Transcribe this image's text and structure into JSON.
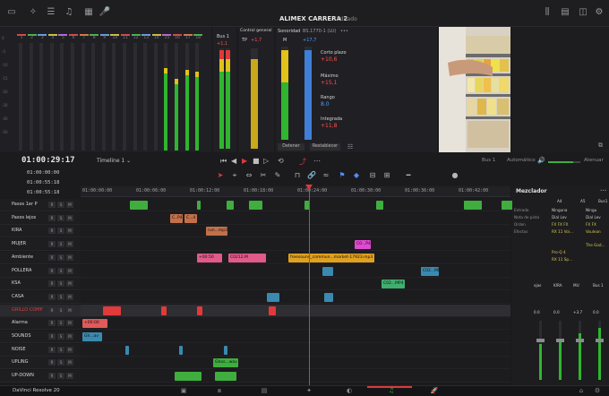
{
  "app": {
    "project_title": "ALIMEX CARRERA 2",
    "project_status": "Editado",
    "brand": "DaVinci Resolve 20"
  },
  "meters": {
    "channel_numbers": [
      "1",
      "2",
      "3",
      "4",
      "5",
      "6",
      "7",
      "8",
      "9",
      "10",
      "11",
      "12",
      "13",
      "14",
      "15",
      "16",
      "17",
      "18"
    ],
    "cap_colors": [
      "#d04a4a",
      "#4fae4f",
      "#6b9ae0",
      "#c8c04a",
      "#b06ad0",
      "#d04a4a",
      "#d07a4a",
      "#4fae4f",
      "#6b9ae0",
      "#c8c04a",
      "#d04a4a",
      "#4fae4f",
      "#6b9ae0",
      "#c8c04a",
      "#b06ad0",
      "#d04a4a",
      "#d07a4a",
      "#4fae4f"
    ],
    "levels": [
      0,
      0,
      0,
      0,
      0,
      0,
      0,
      0,
      0,
      0,
      0,
      0,
      0,
      0,
      0.72,
      0.62,
      0.7,
      0.68
    ],
    "scale_labels": [
      "0",
      "-5",
      "-10",
      "-15",
      "-20",
      "-30",
      "-40",
      "-50"
    ]
  },
  "bus_meter": {
    "label": "Bus 1",
    "value": "+1,1"
  },
  "control": {
    "label": "Control general",
    "tp_label": "TP",
    "tp_value": "+1,7"
  },
  "loudness": {
    "label": "Sonoridad",
    "standard": "BS.1770-1 (LU)",
    "m_label": "M",
    "m_value": "+17,7",
    "corto_plazo_label": "Corto plazo",
    "corto_plazo_value": "+10,6",
    "maximo_label": "Máximo",
    "maximo_value": "+15,1",
    "rango_label": "Rango",
    "rango_value": "8.0",
    "integrada_label": "Integrada",
    "integrada_value": "+11,8",
    "detener_label": "Detener",
    "restablecer_label": "Restablecer"
  },
  "transport": {
    "timecode": "01:00:29:17",
    "timeline_name": "Timeline 1",
    "bus_label": "Bus 1",
    "auto_label": "Automático",
    "atenuar_label": "Atenuar"
  },
  "small_timecodes": [
    "01:00:00:00",
    "01:00:55:18",
    "01:00:55:18"
  ],
  "ruler": {
    "labels": [
      "01:00:00:00",
      "01:00:06:00",
      "01:00:12:00",
      "01:00:18:00",
      "01:00:24:00",
      "01:00:30:00",
      "01:00:36:00",
      "01:00:42:00",
      "01:00:48:00"
    ]
  },
  "tracks": [
    {
      "name": "Pasos 1er P",
      "color": "#3fae3f",
      "clips": [
        {
          "label": "",
          "color": "#3fae3f"
        }
      ]
    },
    {
      "name": "Pasos lejos",
      "color": "#a15a3a",
      "clips": [
        {
          "label": "C..P4",
          "color": "#c2704a"
        },
        {
          "label": "C...4",
          "color": "#c2704a"
        }
      ]
    },
    {
      "name": "KIRA",
      "color": "#a15a3a",
      "clips": [
        {
          "label": "run...mp3",
          "color": "#c2704a"
        }
      ]
    },
    {
      "name": "MUJER",
      "color": "#d04ad0",
      "clips": [
        {
          "label": "C0...P4",
          "color": "#e04ad0"
        }
      ]
    },
    {
      "name": "Ambiente",
      "color": "#e0a020",
      "clips": [
        {
          "label": "+00:50",
          "color": "#e05a8a"
        },
        {
          "label": "C0212.M",
          "color": "#e05a8a"
        },
        {
          "label": "freesound_commun...market-17923.mp3",
          "color": "#e0a020"
        }
      ]
    },
    {
      "name": "POLLERA",
      "color": "#3a8ab0",
      "clips": [
        {
          "label": "",
          "color": "#3a8ab0"
        },
        {
          "label": "C02...MP4",
          "color": "#3a8ab0"
        }
      ]
    },
    {
      "name": "KSA",
      "color": "#3fae6f",
      "clips": [
        {
          "label": "C02...MP4",
          "color": "#3fae6f"
        }
      ]
    },
    {
      "name": "CASA",
      "color": "#3a8ab0",
      "clips": []
    },
    {
      "name": "GRILLO COMP",
      "color": "#e03a3a",
      "clips": []
    },
    {
      "name": "Alarma",
      "color": "#3fae3f",
      "clips": [
        {
          "label": "+00:00",
          "color": "#e05a5a"
        }
      ]
    },
    {
      "name": "SOUNDS",
      "color": "#3a8ab0",
      "clips": [
        {
          "label": "Gh...av",
          "color": "#3a8ab0"
        }
      ]
    },
    {
      "name": "NOISE",
      "color": "#3a8ab0",
      "clips": []
    },
    {
      "name": "UPLING",
      "color": "#3fae3f",
      "clips": [
        {
          "label": "Ghos...wav",
          "color": "#3fae3f"
        }
      ]
    },
    {
      "name": "UP-DOWN",
      "color": "#3fae3f",
      "clips": []
    }
  ],
  "track_buttons": [
    "R",
    "S",
    "M"
  ],
  "mixer": {
    "title": "Mezclador",
    "columns": [
      "A4",
      "A5",
      "Bus1"
    ],
    "rows": [
      {
        "label": "Entrada",
        "values": [
          "Ninguna",
          "Ningu"
        ]
      },
      {
        "label": "Nota de pista",
        "values": [
          "Dial Lev",
          "Dial Lev"
        ]
      },
      {
        "label": "Orden",
        "values": [
          "FX FX FX",
          "FX FX"
        ]
      },
      {
        "label": "Efectos",
        "values": [
          "RX 11 Voi...",
          "Voulean"
        ]
      }
    ],
    "effects_extra": [
      "Pro-Q 4",
      "RX 11 Sp...",
      "The God..."
    ],
    "channel_labels": [
      "ojas",
      "KIRA",
      "MU",
      "Bus 1"
    ],
    "fader_values": [
      "0.0",
      "0.0",
      "+3.7",
      "0.0"
    ]
  },
  "pages": [
    "media",
    "cut",
    "edit",
    "fusion",
    "color",
    "fairlight",
    "deliver"
  ]
}
